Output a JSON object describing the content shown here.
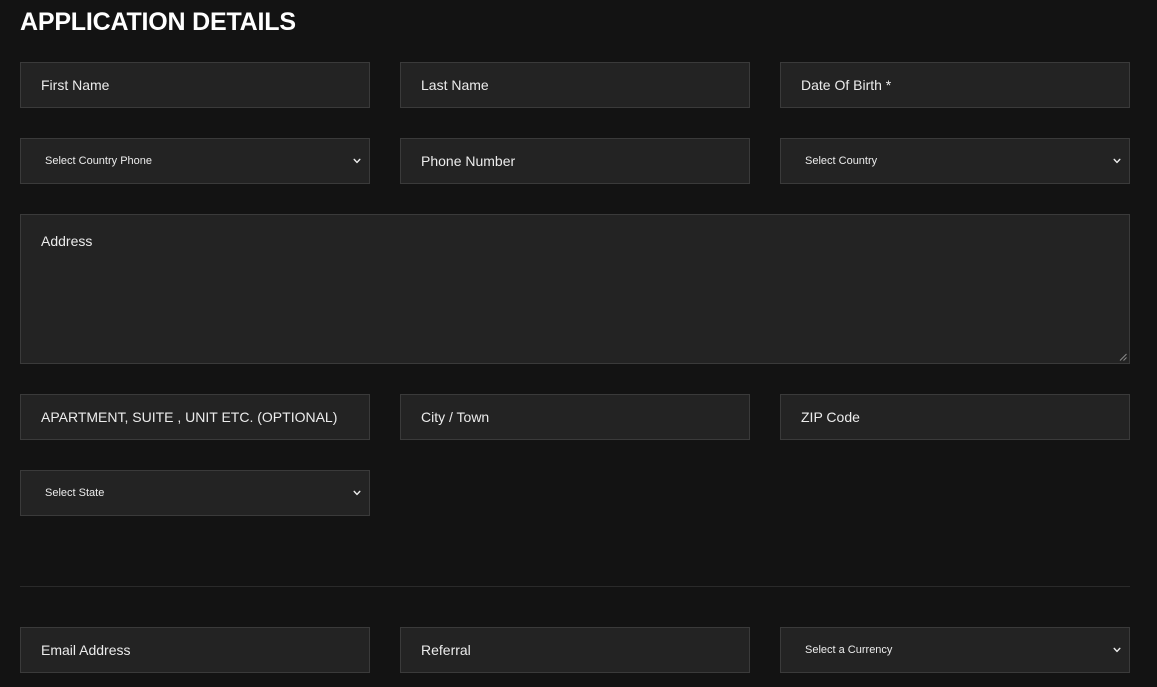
{
  "heading": "APPLICATION DETAILS",
  "fields": {
    "first_name": {
      "placeholder": "First Name",
      "value": ""
    },
    "last_name": {
      "placeholder": "Last Name",
      "value": ""
    },
    "date_of_birth": {
      "placeholder": "Date Of Birth *",
      "value": ""
    },
    "country_phone": {
      "selected": "Select Country Phone"
    },
    "phone_number": {
      "placeholder": "Phone Number",
      "value": ""
    },
    "country": {
      "selected": "Select Country"
    },
    "address": {
      "placeholder": "Address",
      "value": ""
    },
    "apartment": {
      "placeholder": "APARTMENT, SUITE , UNIT ETC. (OPTIONAL)",
      "value": ""
    },
    "city": {
      "placeholder": "City / Town",
      "value": ""
    },
    "zip": {
      "placeholder": "ZIP Code",
      "value": ""
    },
    "state": {
      "selected": "Select State"
    },
    "email": {
      "placeholder": "Email Address",
      "value": ""
    },
    "referral": {
      "placeholder": "Referral",
      "value": ""
    },
    "currency": {
      "selected": "Select a Currency"
    }
  },
  "icons": {
    "dropdown": "chevron-down-icon",
    "resize": "resize-handle-icon"
  },
  "colors": {
    "background": "#131313",
    "field_background": "#232323",
    "field_border": "#3a3a3a",
    "text": "#ececec",
    "heading": "#ffffff"
  }
}
